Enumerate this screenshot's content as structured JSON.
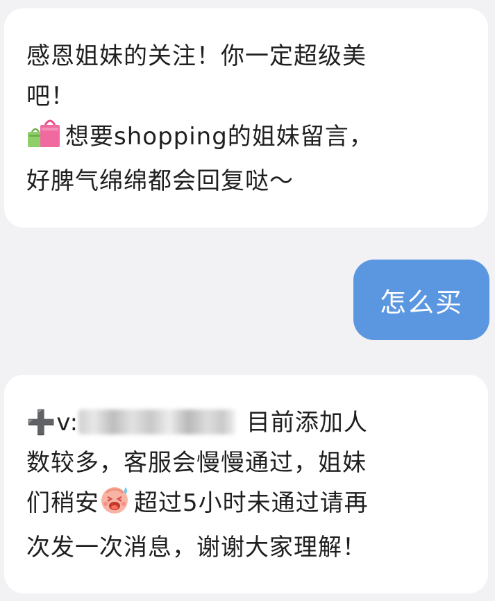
{
  "messages": [
    {
      "side": "incoming",
      "lines": [
        "感恩姐妹的关注！你一定超级美",
        "吧！",
        "想要shopping的姐妹留言，",
        "好脾气绵绵都会回复哒～"
      ],
      "emoji": "shopping-bag-icon"
    },
    {
      "side": "outgoing",
      "text": "怎么买"
    },
    {
      "side": "incoming",
      "plus": "➕",
      "contact_prefix": "v:",
      "line1_tail": "目前添加人",
      "line2": "数较多，客服会慢慢通过，姐妹",
      "line3_head": "们稍安",
      "line3_tail": "超过5小时未通过请再",
      "line4": "次发一次消息，谢谢大家理解！",
      "emoji": "sweating-face-icon"
    }
  ],
  "colors": {
    "background": "#f2f2f4",
    "incoming_bubble": "#ffffff",
    "outgoing_bubble": "#5b97e0",
    "outgoing_text": "#ffffff"
  }
}
